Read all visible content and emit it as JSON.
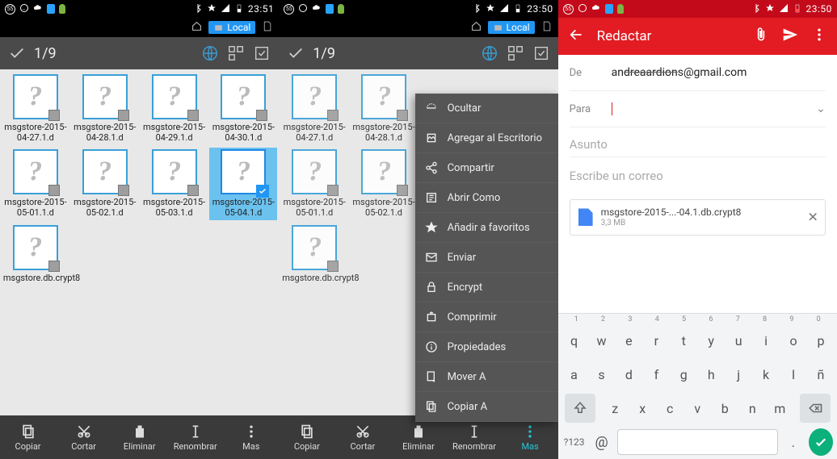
{
  "status": {
    "time1": "23:51",
    "time2": "23:50",
    "time3": "23:50",
    "badge": "55"
  },
  "pathbar": {
    "label": "Local"
  },
  "selection": {
    "count": "1/9"
  },
  "files": [
    {
      "name": "msgstore-2015-04-27.1.d"
    },
    {
      "name": "msgstore-2015-04-28.1.d"
    },
    {
      "name": "msgstore-2015-04-29.1.d"
    },
    {
      "name": "msgstore-2015-04-30.1.d"
    },
    {
      "name": "msgstore-2015-05-01.1.d"
    },
    {
      "name": "msgstore-2015-05-02.1.d"
    },
    {
      "name": "msgstore-2015-05-03.1.d"
    },
    {
      "name": "msgstore-2015-05-04.1.d",
      "selected": true
    },
    {
      "name": "msgstore.db.crypt8"
    }
  ],
  "files2": [
    {
      "name": "msgstore-2015-04-27.1.d"
    },
    {
      "name": "msgstore-2015-04-28.1.d"
    },
    {
      "name": ""
    },
    {
      "name": ""
    },
    {
      "name": "msgstore-2015-05-01.1.d"
    },
    {
      "name": "msgstore-2015-05-02.1.d"
    },
    {
      "name": ""
    },
    {
      "name": ""
    },
    {
      "name": "msgstore.db.crypt8"
    }
  ],
  "toolbar": {
    "copy": "Copiar",
    "cut": "Cortar",
    "delete": "Eliminar",
    "rename": "Renombrar",
    "more": "Mas"
  },
  "popup": [
    "Ocultar",
    "Agregar al Escritorio",
    "Compartir",
    "Abrir Como",
    "Añadir a favoritos",
    "Enviar",
    "Encrypt",
    "Comprimir",
    "Propiedades",
    "Mover A",
    "Copiar A"
  ],
  "gmail": {
    "title": "Redactar",
    "from_lbl": "De",
    "from_pre": "an",
    "from_strike": "dreaardion",
    "from_post": "s@gmail.com",
    "to_lbl": "Para",
    "subject_ph": "Asunto",
    "body_ph": "Escribe un correo",
    "attach_name": "msgstore-2015-...-04.1.db.crypt8",
    "attach_size": "3,3 MB"
  },
  "kb": {
    "nums": [
      "1",
      "2",
      "3",
      "4",
      "5",
      "6",
      "7",
      "8",
      "9",
      "0"
    ],
    "r1": [
      "q",
      "w",
      "e",
      "r",
      "t",
      "y",
      "u",
      "i",
      "o",
      "p"
    ],
    "r2": [
      "a",
      "s",
      "d",
      "f",
      "g",
      "h",
      "j",
      "k",
      "l",
      "ñ"
    ],
    "r3": [
      "z",
      "x",
      "c",
      "v",
      "b",
      "n",
      "m"
    ],
    "sym": "?123",
    "at": "@",
    "dot": "."
  }
}
